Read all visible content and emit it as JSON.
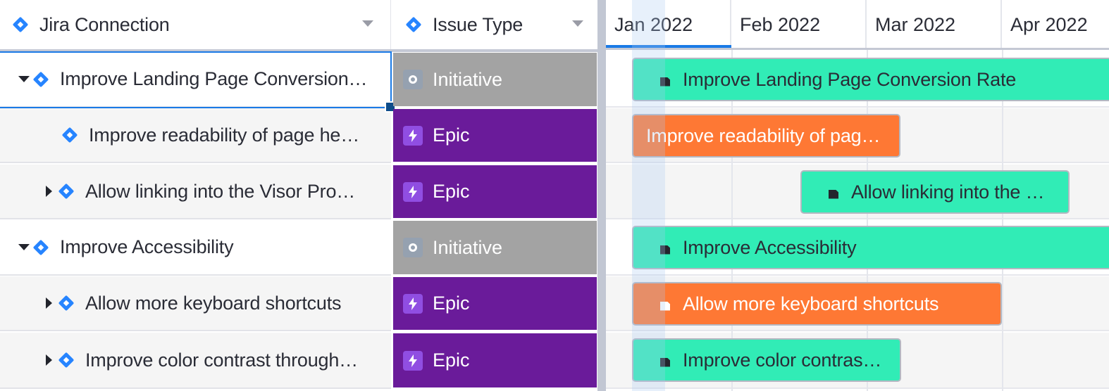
{
  "header": {
    "columns": [
      {
        "label": "Jira Connection",
        "icon": "jira-diamond-icon",
        "menu_icon": "caret-down-icon"
      },
      {
        "label": "Issue Type",
        "icon": "jira-diamond-icon",
        "menu_icon": "caret-down-icon"
      }
    ]
  },
  "timeline": {
    "months": [
      "Jan 2022",
      "Feb 2022",
      "Mar 2022",
      "Apr 2022"
    ],
    "active_month": "Jan 2022"
  },
  "rows": [
    {
      "title": "Improve Landing Page Conversion…",
      "level": 0,
      "expander": "expanded",
      "issue_type": "Initiative",
      "type_icon": "initiative-circle-icon",
      "selected": true,
      "bar": {
        "label": "Improve Landing Page Conversion Rate",
        "color": "green",
        "doc_icon": true
      }
    },
    {
      "title": "Improve readability of page he…",
      "level": 1,
      "expander": "none",
      "issue_type": "Epic",
      "type_icon": "lightning-bolt-icon",
      "bar": {
        "label": "Improve readability of pag…",
        "color": "orange",
        "doc_icon": false
      }
    },
    {
      "title": "Allow linking into the Visor Pro…",
      "level": 1,
      "expander": "collapsed",
      "issue_type": "Epic",
      "type_icon": "lightning-bolt-icon",
      "bar": {
        "label": "Allow linking into the …",
        "color": "green",
        "doc_icon": true
      }
    },
    {
      "title": "Improve Accessibility",
      "level": 0,
      "expander": "expanded",
      "issue_type": "Initiative",
      "type_icon": "initiative-circle-icon",
      "bar": {
        "label": "Improve Accessibility",
        "color": "green",
        "doc_icon": true
      }
    },
    {
      "title": "Allow more keyboard shortcuts",
      "level": 1,
      "expander": "collapsed",
      "issue_type": "Epic",
      "type_icon": "lightning-bolt-icon",
      "bar": {
        "label": "Allow more keyboard shortcuts",
        "color": "orange",
        "doc_icon": true
      }
    },
    {
      "title": "Improve color contrast through…",
      "level": 1,
      "expander": "collapsed",
      "issue_type": "Epic",
      "type_icon": "lightning-bolt-icon",
      "bar": {
        "label": "Improve color contras…",
        "color": "green",
        "doc_icon": true
      }
    }
  ],
  "colors": {
    "accent": "#1a7ae6",
    "jira_blue": "#2684ff",
    "initiative_bg": "#a3a3a3",
    "epic_bg": "#6a1b9a",
    "bar_green": "#31ecb6",
    "bar_orange": "#fe7834"
  }
}
